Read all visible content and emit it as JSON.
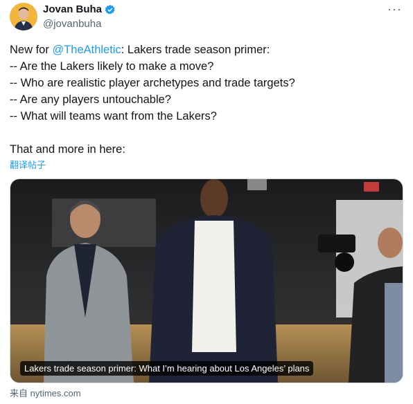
{
  "author": {
    "name": "Jovan Buha",
    "handle": "@jovanbuha",
    "avatar_icon": "avatar-photo",
    "verified_icon": "verified-badge-icon"
  },
  "more_label": "···",
  "tweet": {
    "intro_prefix": "New for ",
    "mention": "@TheAthletic",
    "intro_suffix": ": Lakers trade season primer:",
    "lines": [
      "-- Are the Lakers likely to make a move?",
      "-- Who are realistic player archetypes and trade targets?",
      "-- Are any players untouchable?",
      "-- What will teams want from the Lakers?"
    ],
    "closing": "That and more in here:"
  },
  "translate_label": "翻译帖子",
  "card": {
    "caption": "Lakers trade season primer: What I’m hearing about Los Angeles’ plans",
    "source": "来自 nytimes.com"
  },
  "colors": {
    "link": "#1d9bf0",
    "muted": "#536471",
    "verified": "#1d9bf0"
  }
}
